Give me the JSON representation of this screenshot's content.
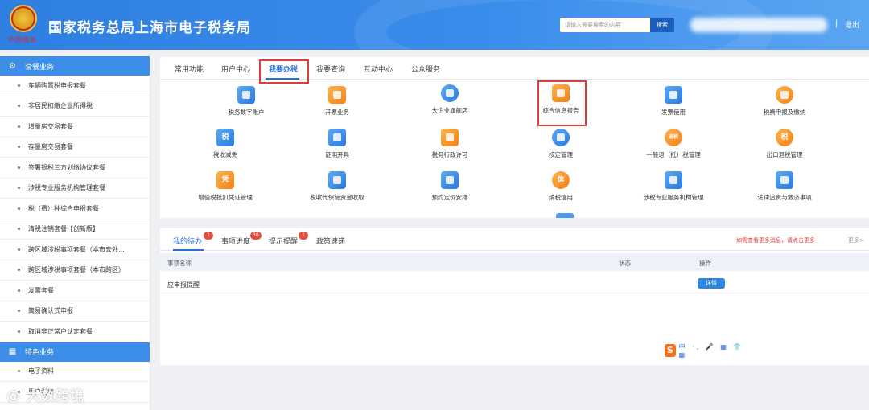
{
  "header": {
    "emblem_text": "中国税务",
    "site_title": "国家税务总局上海市电子税务局",
    "search_placeholder": "请输入需要搜索的内容",
    "search_button": "搜索",
    "separator": "|",
    "logout": "退出"
  },
  "sidebar": {
    "section1": "套餐业务",
    "items1": [
      "车辆购置税申报套餐",
      "非居民扣缴企业所得税",
      "增量房交易套餐",
      "存量房交易套餐",
      "签署银税三方划缴协议套餐",
      "涉税专业服务机构管理套餐",
      "税（费）种综合申报套餐",
      "清税注销套餐【创新版】",
      "跨区域涉税事项套餐（本市去外...",
      "跨区域涉税事项套餐（本市跨区）",
      "发票套餐",
      "简易确认式申报",
      "取消非正常户认定套餐"
    ],
    "section2": "特色业务",
    "items2": [
      "电子资料",
      "用户指南"
    ]
  },
  "top_tabs": [
    "常用功能",
    "用户中心",
    "我要办税",
    "我要查询",
    "互动中心",
    "公众服务"
  ],
  "services": [
    {
      "label": "税务数字账户",
      "icon": "account-icon"
    },
    {
      "label": "开票业务",
      "icon": "invoice-issue-icon"
    },
    {
      "label": "大企业旗舰店",
      "icon": "enterprise-icon"
    },
    {
      "label": "综合信息报告",
      "icon": "report-icon"
    },
    {
      "label": "发票使用",
      "icon": "invoice-use-icon"
    },
    {
      "label": "税费申报及缴纳",
      "icon": "tax-payment-icon"
    },
    {
      "label": "税收减免",
      "icon": "tax-relief-icon"
    },
    {
      "label": "证明开具",
      "icon": "certificate-icon"
    },
    {
      "label": "税务行政许可",
      "icon": "license-icon"
    },
    {
      "label": "核定管理",
      "icon": "assessment-icon"
    },
    {
      "label": "一般退（抵）税管理",
      "icon": "refund-icon"
    },
    {
      "label": "出口退税管理",
      "icon": "export-refund-icon"
    },
    {
      "label": "增值税抵扣凭证管理",
      "icon": "vat-voucher-icon"
    },
    {
      "label": "税收代保管资金收取",
      "icon": "custody-fund-icon"
    },
    {
      "label": "预约定价安排",
      "icon": "pricing-icon"
    },
    {
      "label": "纳税信用",
      "icon": "credit-icon"
    },
    {
      "label": "涉税专业服务机构管理",
      "icon": "agency-icon"
    },
    {
      "label": "法律追责与救济事项",
      "icon": "law-icon"
    }
  ],
  "icon_glyphs": {
    "tax_relief": "税",
    "credit": "信",
    "refund": "退税",
    "export_refund": "税",
    "vat_voucher": "凭"
  },
  "bottom_tabs": [
    {
      "label": "我的待办",
      "badge": "1"
    },
    {
      "label": "事项进度",
      "badge": "30"
    },
    {
      "label": "提示提醒",
      "badge": "1"
    },
    {
      "label": "政策速递",
      "badge": ""
    }
  ],
  "notice": "如需查看更多消息，请点击更多",
  "more": "更多>",
  "table": {
    "headers": [
      "事项名称",
      "状态",
      "操作"
    ],
    "rows": [
      {
        "name": "应申报提醒",
        "status": "",
        "action": "详情"
      }
    ]
  },
  "ime": {
    "logo": "S",
    "text": "中 ·, 🎤 ▦ 👕 ▦"
  },
  "watermark": "@ 大数跨境",
  "colors": {
    "header": "#3a8ceb",
    "accent": "#2b6fd6",
    "highlight": "#e23b3b",
    "sidebar_section": "#3d8ee8"
  }
}
